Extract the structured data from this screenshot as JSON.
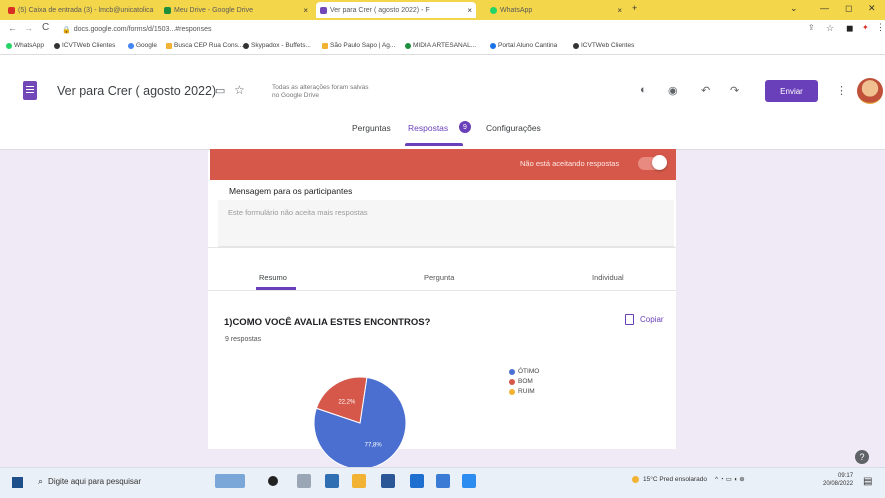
{
  "browser": {
    "tabs": [
      {
        "label": "(5) Caixa de entrada (3) - lmcb@unicatolica",
        "active": false,
        "color": "#d93025"
      },
      {
        "label": "Meu Drive - Google Drive",
        "active": false,
        "color": "#1e8e3e"
      },
      {
        "label": "Ver para Crer ( agosto 2022) - F",
        "active": true,
        "color": "#7248b9"
      },
      {
        "label": "WhatsApp",
        "active": false,
        "color": "#25d366"
      }
    ],
    "new_tab": "+",
    "url": "docs.google.com/forms/d/1503...#responses",
    "bookmarks": [
      "WhatsApp",
      "ICVTWeb Clientes",
      "Google",
      "Busca CEP Rua Cons...",
      "Skypadox - Buffets...",
      "São Paulo Sapo | Ag...",
      "MIDIA ARTESANAL...",
      "Portal Aluno Cantina",
      "ICVTWeb Clientes"
    ]
  },
  "header": {
    "title": "Ver para Crer ( agosto 2022)",
    "save_message": "Todas as alterações foram salvas no Google Drive",
    "send_label": "Enviar",
    "tabs": {
      "questions": "Perguntas",
      "responses": "Respostas",
      "responses_count": "9",
      "settings": "Configurações"
    }
  },
  "card": {
    "not_accepting": "Não está aceitando respostas",
    "accepting_toggle_on": false,
    "message_title": "Mensagem para os participantes",
    "message_text": "Este formulário não aceita mais respostas",
    "subtabs": {
      "summary": "Resumo",
      "question": "Pergunta",
      "individual": "Individual"
    }
  },
  "question": {
    "title": "1)COMO VOCÊ AVALIA ESTES ENCONTROS?",
    "count": "9 respostas",
    "copy_label": "Copiar"
  },
  "chart_data": {
    "type": "pie",
    "categories": [
      "ÓTIMO",
      "BOM",
      "RUIM"
    ],
    "values": [
      77.8,
      22.2,
      0
    ],
    "labels": [
      "77,8%",
      "22,2%",
      ""
    ],
    "colors": [
      "#4a6fd0",
      "#d5584a",
      "#f2b233"
    ],
    "legend_position": "right"
  },
  "taskbar": {
    "search_placeholder": "Digite aqui para pesquisar",
    "weather": "15°C Pred ensolarado",
    "time": "09:17",
    "date": "20/08/2022"
  },
  "help": "?"
}
